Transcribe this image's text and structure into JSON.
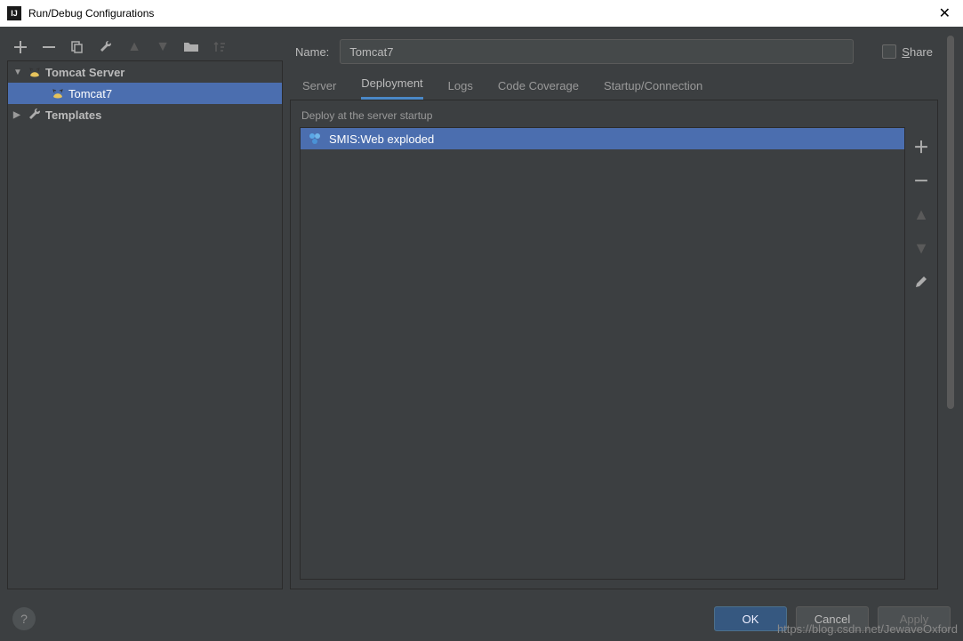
{
  "window": {
    "title": "Run/Debug Configurations"
  },
  "sidebar": {
    "groups": [
      {
        "label": "Tomcat Server",
        "expanded": true,
        "items": [
          {
            "label": "Tomcat7",
            "selected": true
          }
        ]
      },
      {
        "label": "Templates",
        "expanded": false,
        "items": []
      }
    ]
  },
  "form": {
    "name_label": "Name:",
    "name_value": "Tomcat7",
    "share_label": "Share"
  },
  "tabs": [
    {
      "label": "Server",
      "active": false
    },
    {
      "label": "Deployment",
      "active": true
    },
    {
      "label": "Logs",
      "active": false
    },
    {
      "label": "Code Coverage",
      "active": false
    },
    {
      "label": "Startup/Connection",
      "active": false
    }
  ],
  "deployment": {
    "section_label": "Deploy at the server startup",
    "artifacts": [
      {
        "label": "SMIS:Web exploded",
        "selected": true
      }
    ]
  },
  "buttons": {
    "ok": "OK",
    "cancel": "Cancel",
    "apply": "Apply"
  },
  "watermark": "https://blog.csdn.net/JewaveOxford"
}
